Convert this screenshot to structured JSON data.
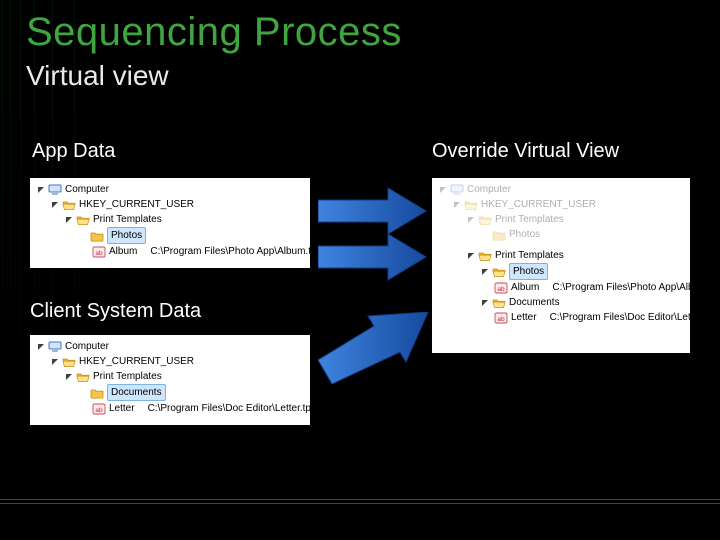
{
  "title": "Sequencing Process",
  "subtitle": "Virtual view",
  "sections": {
    "app": "App Data",
    "client": "Client System Data",
    "override": "Override Virtual View"
  },
  "icons": {
    "computer": "computer-icon",
    "folder": "folder-icon",
    "folder_open": "folder-open-icon",
    "reg_string": "reg-string-icon"
  },
  "nodes": {
    "computer": "Computer",
    "hkcu": "HKEY_CURRENT_USER",
    "print_templates": "Print Templates",
    "photos": "Photos",
    "documents": "Documents",
    "album": "Album",
    "letter": "Letter"
  },
  "values": {
    "album": "C:\\Program Files\\Photo App\\Album.tpl",
    "letter": "C:\\Program Files\\Doc Editor\\Letter.tpl"
  },
  "colors": {
    "accent": "#3fa541",
    "arrow1": "#2f6fd1",
    "arrow2": "#1f4fa8"
  }
}
